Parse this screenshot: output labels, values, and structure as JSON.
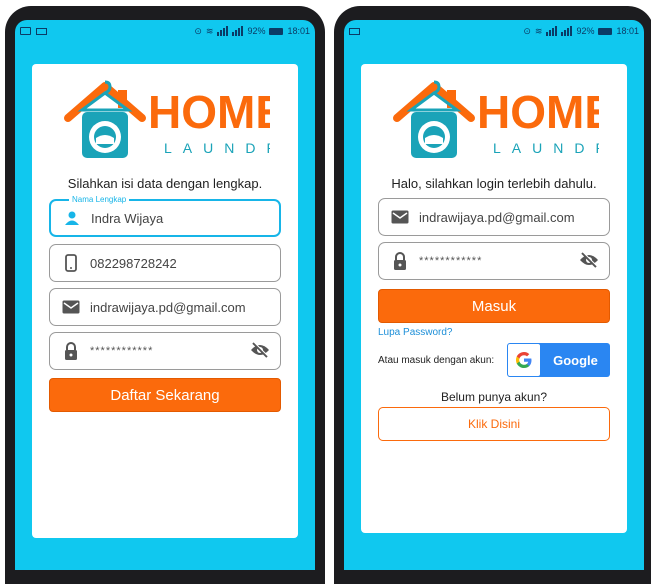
{
  "colors": {
    "screen_bg": "#10c8ef",
    "brand_orange": "#fb6a0c",
    "brand_teal": "#1aa3b8",
    "focus_blue": "#17b5e8",
    "google_blue": "#2a86f2"
  },
  "logo": {
    "word": "HOME",
    "sub": "LAUNDRY"
  },
  "register": {
    "status": {
      "battery": "92%",
      "time": "18:01"
    },
    "prompt": "Silahkan isi data dengan lengkap.",
    "name_label": "Nama Lengkap",
    "name_value": "Indra Wijaya",
    "phone_value": "082298728242",
    "email_value": "indrawijaya.pd@gmail.com",
    "password_value": "************",
    "submit_label": "Daftar Sekarang"
  },
  "login": {
    "status": {
      "battery": "92%",
      "time": "18:01"
    },
    "prompt": "Halo, silahkan login terlebih dahulu.",
    "email_value": "indrawijaya.pd@gmail.com",
    "password_value": "************",
    "submit_label": "Masuk",
    "forgot_label": "Lupa Password?",
    "alt_login_label": "Atau masuk dengan akun:",
    "google_label": "Google",
    "no_account_text": "Belum punya akun?",
    "signup_label": "Klik Disini"
  }
}
